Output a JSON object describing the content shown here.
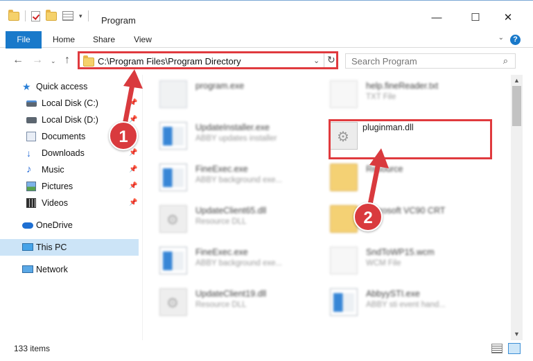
{
  "window": {
    "title": "Program",
    "minimize_glyph": "—",
    "maximize_glyph": "☐",
    "close_glyph": "✕"
  },
  "ribbon": {
    "tabs": [
      "File",
      "Home",
      "Share",
      "View"
    ],
    "help_glyph": "?"
  },
  "nav": {
    "address_path": "C:\\Program Files\\Program Directory",
    "search_placeholder": "Search Program"
  },
  "sidebar": {
    "items": [
      {
        "label": "Quick access",
        "icon": "star-icon"
      },
      {
        "label": "Local Disk (C:)",
        "icon": "disk-icon"
      },
      {
        "label": "Local Disk (D:)",
        "icon": "disk-icon"
      },
      {
        "label": "Documents",
        "icon": "documents-icon"
      },
      {
        "label": "Downloads",
        "icon": "downloads-icon"
      },
      {
        "label": "Music",
        "icon": "music-icon"
      },
      {
        "label": "Pictures",
        "icon": "pictures-icon"
      },
      {
        "label": "Videos",
        "icon": "videos-icon"
      },
      {
        "label": "OneDrive",
        "icon": "cloud-icon"
      },
      {
        "label": "This PC",
        "icon": "computer-icon"
      },
      {
        "label": "Network",
        "icon": "network-icon"
      }
    ]
  },
  "files": [
    {
      "name": "program.exe",
      "type": ""
    },
    {
      "name": "help.fineReader.txt",
      "type": "TXT File"
    },
    {
      "name": "UpdateInstaller.exe",
      "type": "ABBY updates installer"
    },
    {
      "name": "pluginman.dll",
      "type": ""
    },
    {
      "name": "FineExec.exe",
      "type": "ABBY background exe..."
    },
    {
      "name": "Resource",
      "type": ""
    },
    {
      "name": "UpdateClient65.dll",
      "type": "Resource DLL"
    },
    {
      "name": "Microsoft VC90 CRT",
      "type": ""
    },
    {
      "name": "FineExec.exe",
      "type": "ABBY background exe..."
    },
    {
      "name": "SndToWP15.wcm",
      "type": "WCM File"
    },
    {
      "name": "UpdateClient19.dll",
      "type": "Resource DLL"
    },
    {
      "name": "AbbyySTI.exe",
      "type": "ABBY sti event hand..."
    }
  ],
  "status": {
    "item_count": "133 items"
  },
  "annotations": {
    "badge_1": "1",
    "badge_2": "2",
    "color": "#d93a3e"
  }
}
